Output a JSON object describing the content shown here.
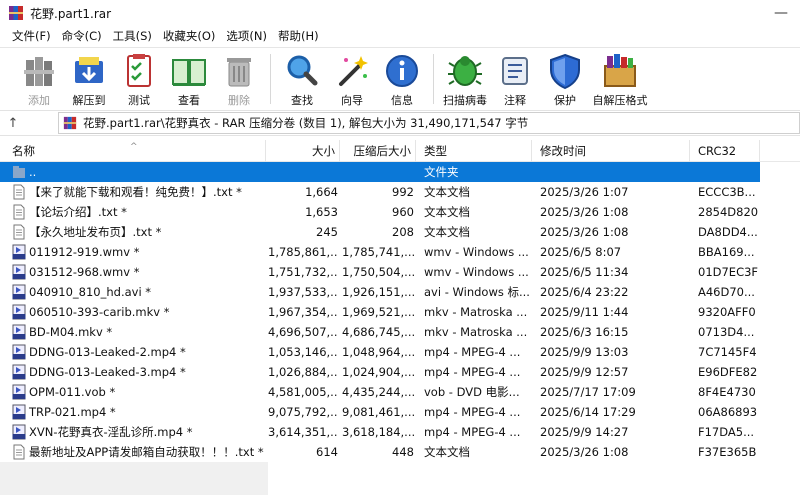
{
  "window": {
    "title": "花野.part1.rar",
    "minimize_glyph": "—"
  },
  "menu": [
    "文件(F)",
    "命令(C)",
    "工具(S)",
    "收藏夹(O)",
    "选项(N)",
    "帮助(H)"
  ],
  "toolbar": {
    "add": "添加",
    "extract": "解压到",
    "test": "测试",
    "view": "查看",
    "delete": "删除",
    "find": "查找",
    "wizard": "向导",
    "info": "信息",
    "virus": "扫描病毒",
    "comment": "注释",
    "protect": "保护",
    "sfx": "自解压格式"
  },
  "path": {
    "up_glyph": "↑",
    "text": "花野.part1.rar\\花野真衣 - RAR 压缩分卷 (数目 1), 解包大小为 31,490,171,547 字节"
  },
  "columns": {
    "name": "名称",
    "size": "大小",
    "packed": "压缩后大小",
    "type": "类型",
    "modified": "修改时间",
    "crc": "CRC32",
    "sort_glyph": "^"
  },
  "rows": [
    {
      "name": "..",
      "size": "",
      "packed": "",
      "type": "文件夹",
      "modified": "",
      "crc": "",
      "icon": "folder-icon",
      "selected": true
    },
    {
      "name": "【来了就能下载和观看！纯免费！】.txt *",
      "size": "1,664",
      "packed": "992",
      "type": "文本文档",
      "modified": "2025/3/26 1:07",
      "crc": "ECCC3B...",
      "icon": "text-file-icon"
    },
    {
      "name": "【论坛介绍】.txt *",
      "size": "1,653",
      "packed": "960",
      "type": "文本文档",
      "modified": "2025/3/26 1:08",
      "crc": "2854D820",
      "icon": "text-file-icon"
    },
    {
      "name": "【永久地址发布页】.txt *",
      "size": "245",
      "packed": "208",
      "type": "文本文档",
      "modified": "2025/3/26 1:08",
      "crc": "DA8DD4...",
      "icon": "text-file-icon"
    },
    {
      "name": "011912-919.wmv *",
      "size": "1,785,861,...",
      "packed": "1,785,741,...",
      "type": "wmv - Windows ...",
      "modified": "2025/6/5 8:07",
      "crc": "BBA169...",
      "icon": "video-file-icon",
      "badge": "WMV"
    },
    {
      "name": "031512-968.wmv *",
      "size": "1,751,732,...",
      "packed": "1,750,504,...",
      "type": "wmv - Windows ...",
      "modified": "2025/6/5 11:34",
      "crc": "01D7EC3F",
      "icon": "video-file-icon",
      "badge": "WMV"
    },
    {
      "name": "040910_810_hd.avi *",
      "size": "1,937,533,...",
      "packed": "1,926,151,...",
      "type": "avi - Windows 标...",
      "modified": "2025/6/4 23:22",
      "crc": "A46D70...",
      "icon": "video-file-icon",
      "badge": "AVI"
    },
    {
      "name": "060510-393-carib.mkv *",
      "size": "1,967,354,...",
      "packed": "1,969,521,...",
      "type": "mkv - Matroska ...",
      "modified": "2025/9/11 1:44",
      "crc": "9320AFF0",
      "icon": "video-file-icon",
      "badge": "MKV"
    },
    {
      "name": "BD-M04.mkv *",
      "size": "4,696,507,...",
      "packed": "4,686,745,...",
      "type": "mkv - Matroska ...",
      "modified": "2025/6/3 16:15",
      "crc": "0713D4...",
      "icon": "video-file-icon",
      "badge": "MKV"
    },
    {
      "name": "DDNG-013-Leaked-2.mp4 *",
      "size": "1,053,146,...",
      "packed": "1,048,964,...",
      "type": "mp4 - MPEG-4 ...",
      "modified": "2025/9/9 13:03",
      "crc": "7C7145F4",
      "icon": "video-file-icon",
      "badge": "MP4"
    },
    {
      "name": "DDNG-013-Leaked-3.mp4 *",
      "size": "1,026,884,...",
      "packed": "1,024,904,...",
      "type": "mp4 - MPEG-4 ...",
      "modified": "2025/9/9 12:57",
      "crc": "E96DFE82",
      "icon": "video-file-icon",
      "badge": "MP4"
    },
    {
      "name": "OPM-011.vob *",
      "size": "4,581,005,...",
      "packed": "4,435,244,...",
      "type": "vob - DVD 电影...",
      "modified": "2025/7/17 17:09",
      "crc": "8F4E4730",
      "icon": "video-file-icon",
      "badge": "VOB"
    },
    {
      "name": "TRP-021.mp4 *",
      "size": "9,075,792,...",
      "packed": "9,081,461,...",
      "type": "mp4 - MPEG-4 ...",
      "modified": "2025/6/14 17:29",
      "crc": "06A86893",
      "icon": "video-file-icon",
      "badge": "MP4"
    },
    {
      "name": "XVN-花野真衣-淫乱诊所.mp4 *",
      "size": "3,614,351,...",
      "packed": "3,618,184,...",
      "type": "mp4 - MPEG-4 ...",
      "modified": "2025/9/9 14:27",
      "crc": "F17DA5...",
      "icon": "video-file-icon",
      "badge": "MP4"
    },
    {
      "name": "最新地址及APP请发邮箱自动获取！！！.txt *",
      "size": "614",
      "packed": "448",
      "type": "文本文档",
      "modified": "2025/3/26 1:08",
      "crc": "F37E365B",
      "icon": "text-file-icon"
    }
  ]
}
